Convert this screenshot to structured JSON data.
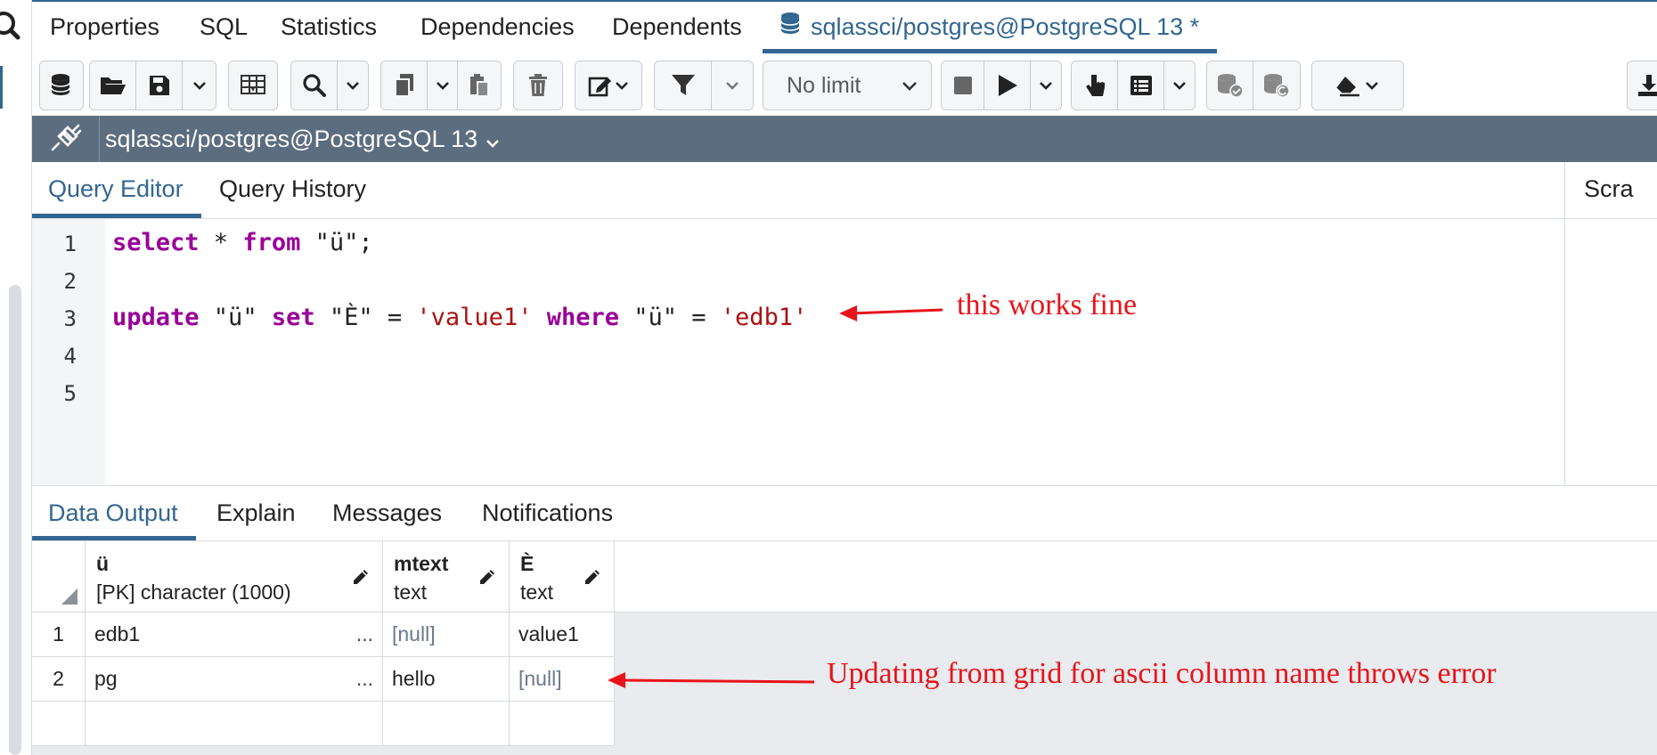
{
  "top_tabs": [
    {
      "label": "Properties"
    },
    {
      "label": "SQL"
    },
    {
      "label": "Statistics"
    },
    {
      "label": "Dependencies"
    },
    {
      "label": "Dependents"
    },
    {
      "label": "sqlassci/postgres@PostgreSQL 13 *",
      "active": true
    }
  ],
  "toolbar": {
    "limit_value": "No limit"
  },
  "connection": {
    "label": "sqlassci/postgres@PostgreSQL 13"
  },
  "editor_tabs": [
    {
      "label": "Query Editor",
      "active": true
    },
    {
      "label": "Query History"
    }
  ],
  "scratch_label": "Scra",
  "code": {
    "line_numbers": [
      "1",
      "2",
      "3",
      "4",
      "5"
    ],
    "line1": {
      "kw1": "select",
      "op": " * ",
      "kw2": "from",
      "rest": " \"ü\";"
    },
    "line3": {
      "kw1": "update",
      "t1": " \"ü\" ",
      "kw2": "set",
      "t2": " \"È\" = ",
      "s1": "'value1'",
      "t3": " ",
      "kw3": "where",
      "t4": " \"ü\" = ",
      "s2": "'edb1'"
    }
  },
  "annotations": {
    "top": "this works fine",
    "bottom": "Updating from grid for ascii column name throws error",
    "color": "#e8141a"
  },
  "output_tabs": [
    {
      "label": "Data Output",
      "active": true
    },
    {
      "label": "Explain"
    },
    {
      "label": "Messages"
    },
    {
      "label": "Notifications"
    }
  ],
  "grid": {
    "columns": [
      {
        "name": "ü",
        "type": "[PK] character (1000)"
      },
      {
        "name": "mtext",
        "type": "text"
      },
      {
        "name": "È",
        "type": "text"
      }
    ],
    "rows": [
      {
        "num": "1",
        "c1": "edb1",
        "c1_more": "...",
        "c2": "[null]",
        "c3": "value1"
      },
      {
        "num": "2",
        "c1": "pg",
        "c1_more": "...",
        "c2": "hello",
        "c3": "[null]"
      }
    ]
  },
  "colors": {
    "accent": "#326690",
    "connection_bar": "#5b6d7e",
    "keyword": "#990099",
    "string": "#aa1111"
  }
}
